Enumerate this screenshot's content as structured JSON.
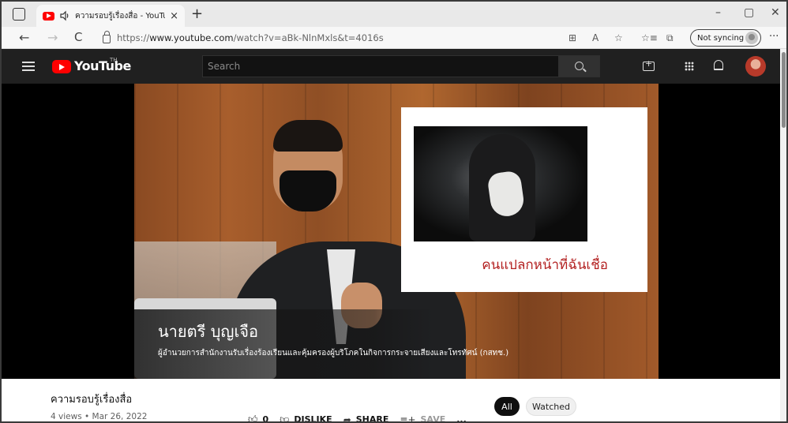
{
  "browser": {
    "tab_title": "ความรอบรู้เรื่องสื่อ - YouTube",
    "tab_close": "×",
    "new_tab": "+",
    "url_prefix": "https://",
    "url_domain": "www.youtube.com",
    "url_path": "/watch?v=aBk-NlnMxls&t=4016s",
    "sync_label": "Not syncing",
    "more": "···",
    "window_buttons": [
      "–",
      "▢",
      "✕"
    ],
    "nav": [
      "←",
      "→",
      "C"
    ],
    "toolbar_icons": [
      "⊞",
      "A",
      "☆",
      "☆≡",
      "⧉"
    ]
  },
  "youtube": {
    "logo_text": "YouTube",
    "country_code": "TH",
    "search_placeholder": "Search"
  },
  "video": {
    "speaker_name": "นายตรี บุญเจือ",
    "speaker_role": "ผู้อำนวยการสำนักงานรับเรื่องร้องเรียนและคุ้มครองผู้บริโภคในกิจการกระจายเสียงและโทรทัศน์ (กสทช.)",
    "slide_caption": "คนแปลกหน้าที่ฉันเชื่อ"
  },
  "details": {
    "title": "ความรอบรู้เรื่องสื่อ",
    "meta": "4 views • Mar 26, 2022",
    "like_count": "0",
    "dislike_label": "DISLIKE",
    "share_label": "SHARE",
    "save_label": "SAVE",
    "more": "..."
  },
  "chips": {
    "all": "All",
    "watched": "Watched"
  },
  "colors": {
    "brand_red": "#ff0000",
    "masthead": "#202020",
    "caption_red": "#b32121"
  }
}
